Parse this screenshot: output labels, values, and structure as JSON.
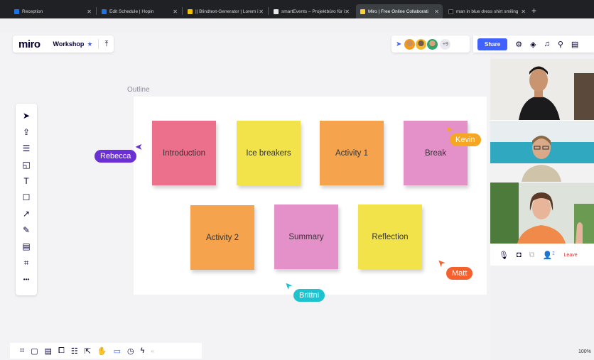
{
  "browser": {
    "tabs": [
      {
        "title": "Reception",
        "favicon_color": "#1a73e8"
      },
      {
        "title": "Edit Schedule | Hopin",
        "favicon_color": "#1a73e8"
      },
      {
        "title": "|| Blindtext-Generator | Lorem i",
        "favicon_color": "#f2c200"
      },
      {
        "title": "smartEvents – Projektbüro für i",
        "favicon_color": "#e8e8e8"
      },
      {
        "title": "Miro | Free Online Collaborati",
        "favicon_color": "#ffd02f"
      },
      {
        "title": "man in blue dress shirt smiling",
        "favicon_color": "#111111"
      }
    ],
    "close_glyph": "✕",
    "new_tab_glyph": "+"
  },
  "header": {
    "logo": "miro",
    "board_name": "Workshop",
    "star_icon": "★",
    "export_icon": "⤒",
    "collaborator_count": "+9",
    "share_label": "Share",
    "right_icons": [
      "settings-sliders-icon",
      "learn-icon",
      "notification-bell-icon",
      "search-icon",
      "notes-icon"
    ]
  },
  "toolbar": {
    "tools": [
      {
        "name": "select-tool-icon",
        "glyph": "➤"
      },
      {
        "name": "upload-tool-icon",
        "glyph": "⇪"
      },
      {
        "name": "templates-tool-icon",
        "glyph": "☰"
      },
      {
        "name": "sticky-note-tool-icon",
        "glyph": "◱"
      },
      {
        "name": "text-tool-icon",
        "glyph": "T"
      },
      {
        "name": "shape-tool-icon",
        "glyph": "☐"
      },
      {
        "name": "line-tool-icon",
        "glyph": "↗"
      },
      {
        "name": "pen-tool-icon",
        "glyph": "✎"
      },
      {
        "name": "comment-tool-icon",
        "glyph": "▤"
      },
      {
        "name": "frame-tool-icon",
        "glyph": "⌗"
      },
      {
        "name": "more-tools-icon",
        "glyph": "•••"
      }
    ]
  },
  "frame": {
    "label": "Outline"
  },
  "stickies": [
    {
      "label": "Introduction",
      "color": "#ec6f8c"
    },
    {
      "label": "Ice breakers",
      "color": "#f2e34a"
    },
    {
      "label": "Activity 1",
      "color": "#f6a34e"
    },
    {
      "label": "Break",
      "color": "#e490c9"
    },
    {
      "label": "Activity 2",
      "color": "#f6a34e"
    },
    {
      "label": "Summary",
      "color": "#e490c9"
    },
    {
      "label": "Reflection",
      "color": "#f2e34a"
    }
  ],
  "cursors": [
    {
      "name": "Rebecca",
      "color": "#6b2fd6"
    },
    {
      "name": "Kevin",
      "color": "#f5a623"
    },
    {
      "name": "Matt",
      "color": "#f5612e"
    },
    {
      "name": "Brittni",
      "color": "#1fc3d0"
    }
  ],
  "video": {
    "leave_label": "Leave",
    "participant_badge": "2",
    "controls": [
      "microphone-icon",
      "camera-icon",
      "screen-share-icon",
      "participants-icon"
    ]
  },
  "bottom_bar": {
    "icons": [
      "frames-icon",
      "comments-icon",
      "chat-icon",
      "cards-icon",
      "kanban-icon",
      "screenshare-icon",
      "voting-icon",
      "video-chat-icon",
      "timer-icon",
      "more-apps-icon"
    ]
  },
  "zoom_level": "100%"
}
